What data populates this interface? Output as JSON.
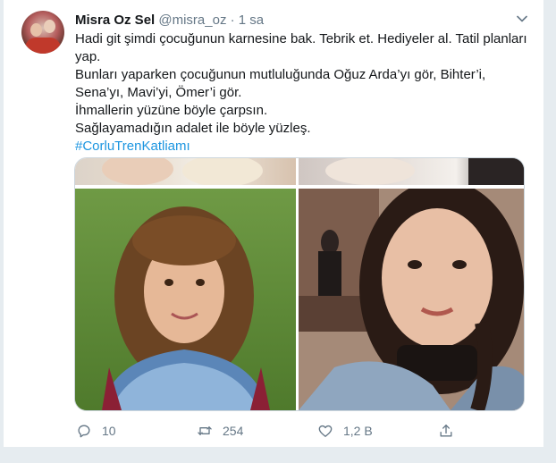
{
  "tweet": {
    "author": {
      "name": "Misra Oz Sel",
      "handle": "@misra_oz",
      "separator": "·",
      "time": "1 sa"
    },
    "lines": [
      "Hadi git şimdi çocuğunun karnesine bak. Tebrik et. Hediyeler al. Tatil planları",
      "yap.",
      "Bunları yaparken çocuğunun mutluluğunda Oğuz Arda’yı gör, Bihter’i,",
      "Sena’yı, Mavi’yi, Ömer’i gör.",
      "İhmallerin yüzüne böyle çarpsın.",
      "Sağlayamadığın adalet ile böyle yüzleş."
    ],
    "hashtag": "#CorluTrenKatliamı",
    "actions": {
      "reply_count": "10",
      "retweet_count": "254",
      "like_count": "1,2 B"
    },
    "icons": [
      "caret-down-icon",
      "reply-icon",
      "retweet-icon",
      "like-icon",
      "share-icon"
    ],
    "colors": {
      "link": "#1b95e0",
      "muted": "#657786",
      "text": "#14171a",
      "border": "#ccd6dd"
    }
  }
}
